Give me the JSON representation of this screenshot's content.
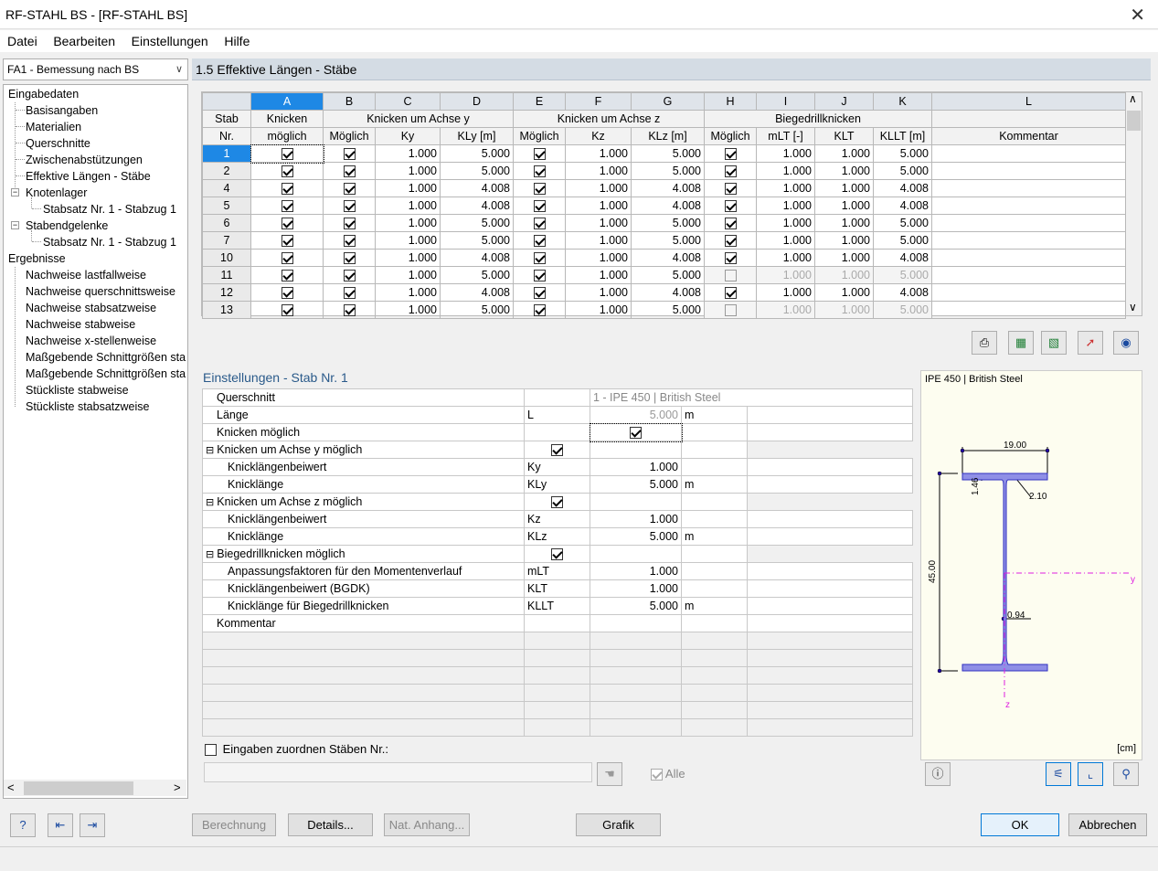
{
  "window": {
    "title": "RF-STAHL BS - [RF-STAHL BS]",
    "close": "✕"
  },
  "menu": [
    "Datei",
    "Bearbeiten",
    "Einstellungen",
    "Hilfe"
  ],
  "case_select": {
    "value": "FA1 - Bemessung nach BS"
  },
  "tree": {
    "input_header": "Eingabedaten",
    "input_items": [
      "Basisangaben",
      "Materialien",
      "Querschnitte",
      "Zwischenabstützungen",
      "Effektive Längen - Stäbe"
    ],
    "nodal_supports": "Knotenlager",
    "nodal_support_child": "Stabsatz Nr. 1 - Stabzug 1",
    "member_hinges": "Stabendgelenke",
    "member_hinge_child": "Stabsatz Nr. 1 - Stabzug 1",
    "results_header": "Ergebnisse",
    "result_items": [
      "Nachweise lastfallweise",
      "Nachweise querschnittsweise",
      "Nachweise stabsatzweise",
      "Nachweise stabweise",
      "Nachweise x-stellenweise",
      "Maßgebende Schnittgrößen sta",
      "Maßgebende Schnittgrößen sta",
      "Stückliste stabweise",
      "Stückliste stabsatzweise"
    ]
  },
  "panel_title": "1.5 Effektive Längen - Stäbe",
  "grid": {
    "col_letters": [
      "A",
      "B",
      "C",
      "D",
      "E",
      "F",
      "G",
      "H",
      "I",
      "J",
      "K",
      "L"
    ],
    "hdr": {
      "stab": "Stab",
      "nr": "Nr.",
      "knicken": "Knicken",
      "moeglich": "möglich",
      "achse_y": "Knicken um Achse y",
      "achse_z": "Knicken um Achse z",
      "bgdk": "Biegedrillknicken",
      "b": "Möglich",
      "c": "Ky",
      "d": "KLy [m]",
      "e": "Möglich",
      "f": "Kz",
      "g": "KLz [m]",
      "h": "Möglich",
      "i": "mLT [-]",
      "j": "KLT",
      "k": "KLLT [m]",
      "l": "Kommentar"
    },
    "rows": [
      {
        "nr": "1",
        "a": true,
        "b": true,
        "ky": "1.000",
        "kly": "5.000",
        "e": true,
        "kz": "1.000",
        "klz": "5.000",
        "h": true,
        "mlt": "1.000",
        "klt": "1.000",
        "kllt": "5.000"
      },
      {
        "nr": "2",
        "a": true,
        "b": true,
        "ky": "1.000",
        "kly": "5.000",
        "e": true,
        "kz": "1.000",
        "klz": "5.000",
        "h": true,
        "mlt": "1.000",
        "klt": "1.000",
        "kllt": "5.000"
      },
      {
        "nr": "4",
        "a": true,
        "b": true,
        "ky": "1.000",
        "kly": "4.008",
        "e": true,
        "kz": "1.000",
        "klz": "4.008",
        "h": true,
        "mlt": "1.000",
        "klt": "1.000",
        "kllt": "4.008"
      },
      {
        "nr": "5",
        "a": true,
        "b": true,
        "ky": "1.000",
        "kly": "4.008",
        "e": true,
        "kz": "1.000",
        "klz": "4.008",
        "h": true,
        "mlt": "1.000",
        "klt": "1.000",
        "kllt": "4.008"
      },
      {
        "nr": "6",
        "a": true,
        "b": true,
        "ky": "1.000",
        "kly": "5.000",
        "e": true,
        "kz": "1.000",
        "klz": "5.000",
        "h": true,
        "mlt": "1.000",
        "klt": "1.000",
        "kllt": "5.000"
      },
      {
        "nr": "7",
        "a": true,
        "b": true,
        "ky": "1.000",
        "kly": "5.000",
        "e": true,
        "kz": "1.000",
        "klz": "5.000",
        "h": true,
        "mlt": "1.000",
        "klt": "1.000",
        "kllt": "5.000"
      },
      {
        "nr": "10",
        "a": true,
        "b": true,
        "ky": "1.000",
        "kly": "4.008",
        "e": true,
        "kz": "1.000",
        "klz": "4.008",
        "h": true,
        "mlt": "1.000",
        "klt": "1.000",
        "kllt": "4.008"
      },
      {
        "nr": "11",
        "a": true,
        "b": true,
        "ky": "1.000",
        "kly": "5.000",
        "e": true,
        "kz": "1.000",
        "klz": "5.000",
        "h": false,
        "mlt": "1.000",
        "klt": "1.000",
        "kllt": "5.000"
      },
      {
        "nr": "12",
        "a": true,
        "b": true,
        "ky": "1.000",
        "kly": "4.008",
        "e": true,
        "kz": "1.000",
        "klz": "4.008",
        "h": true,
        "mlt": "1.000",
        "klt": "1.000",
        "kllt": "4.008"
      },
      {
        "nr": "13",
        "a": true,
        "b": true,
        "ky": "1.000",
        "kly": "5.000",
        "e": true,
        "kz": "1.000",
        "klz": "5.000",
        "h": false,
        "mlt": "1.000",
        "klt": "1.000",
        "kllt": "5.000"
      }
    ]
  },
  "settings": {
    "title": "Einstellungen - Stab Nr. 1",
    "rows": [
      {
        "label": "Querschnitt",
        "sym": "",
        "val": "1 - IPE 450 | British Steel",
        "unit": "",
        "type": "span"
      },
      {
        "label": "Länge",
        "sym": "L",
        "val": "5.000",
        "unit": "m",
        "type": "dis"
      },
      {
        "label": "Knicken möglich",
        "sym": "",
        "val": "",
        "unit": "",
        "type": "cb"
      },
      {
        "label": "Knicken um Achse y möglich",
        "sym": "",
        "val": "",
        "unit": "",
        "type": "cbg"
      },
      {
        "label": "Knicklängenbeiwert",
        "sym": "Ky",
        "val": "1.000",
        "unit": "",
        "type": "sub"
      },
      {
        "label": "Knicklänge",
        "sym": "KLy",
        "val": "5.000",
        "unit": "m",
        "type": "sub"
      },
      {
        "label": "Knicken um Achse z möglich",
        "sym": "",
        "val": "",
        "unit": "",
        "type": "cbg"
      },
      {
        "label": "Knicklängenbeiwert",
        "sym": "Kz",
        "val": "1.000",
        "unit": "",
        "type": "sub"
      },
      {
        "label": "Knicklänge",
        "sym": "KLz",
        "val": "5.000",
        "unit": "m",
        "type": "sub"
      },
      {
        "label": "Biegedrillknicken möglich",
        "sym": "",
        "val": "",
        "unit": "",
        "type": "cbg"
      },
      {
        "label": "Anpassungsfaktoren für den Momentenverlauf",
        "sym": "mLT",
        "val": "1.000",
        "unit": "",
        "type": "sub"
      },
      {
        "label": "Knicklängenbeiwert (BGDK)",
        "sym": "KLT",
        "val": "1.000",
        "unit": "",
        "type": "sub"
      },
      {
        "label": "Knicklänge für Biegedrillknicken",
        "sym": "KLLT",
        "val": "5.000",
        "unit": "m",
        "type": "sub"
      },
      {
        "label": "Kommentar",
        "sym": "",
        "val": "",
        "unit": "",
        "type": "plain"
      }
    ],
    "assign_label": "Eingaben zuordnen Stäben Nr.:",
    "alle": "Alle"
  },
  "preview": {
    "caption": "IPE 450 | British Steel",
    "dim_b": "19.00",
    "dim_tf": "1.46",
    "dim_r": "2.10",
    "dim_h": "45.00",
    "dim_tw": "0.94",
    "axis_y": "y",
    "axis_z": "z",
    "unit": "[cm]",
    "section_color": "#5b5bd6"
  },
  "buttons": {
    "berechnung": "Berechnung",
    "details": "Details...",
    "nat": "Nat. Anhang...",
    "grafik": "Grafik",
    "ok": "OK",
    "abbrechen": "Abbrechen"
  }
}
